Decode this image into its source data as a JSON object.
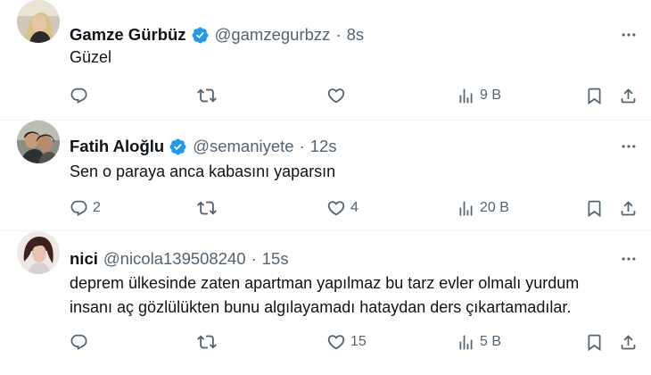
{
  "tweets": [
    {
      "name": "Gamze Gürbüz",
      "verified": true,
      "handle": "@gamzegurbzz",
      "separator": "·",
      "time": "8s",
      "text": "Güzel",
      "replies": "",
      "reposts": "",
      "likes": "",
      "views": "9 B"
    },
    {
      "name": "Fatih Aloğlu",
      "verified": true,
      "handle": "@semaniyete",
      "separator": "·",
      "time": "12s",
      "text": "Sen o paraya anca kabasını yaparsın",
      "replies": "2",
      "reposts": "",
      "likes": "4",
      "views": "20 B"
    },
    {
      "name": "nici",
      "verified": false,
      "handle": "@nicola139508240",
      "separator": "·",
      "time": "15s",
      "text_line1": "deprem ülkesinde zaten apartman yapılmaz bu tarz evler olmalı yurdum",
      "text_line2": "insanı aç gözlülükten bunu algılayamadı hataydan ders çıkartamadılar.",
      "replies": "",
      "reposts": "",
      "likes": "15",
      "views": "5 B"
    }
  ],
  "icons": {
    "reply": "reply-icon",
    "repost": "repost-icon",
    "like": "like-icon",
    "views": "views-icon",
    "bookmark": "bookmark-icon",
    "share": "share-icon",
    "more": "more-icon",
    "verified": "verified-badge-icon"
  },
  "colors": {
    "text": "#0f1419",
    "secondary": "#536471",
    "verified": "#1d9bf0",
    "divider": "#eff3f4"
  }
}
